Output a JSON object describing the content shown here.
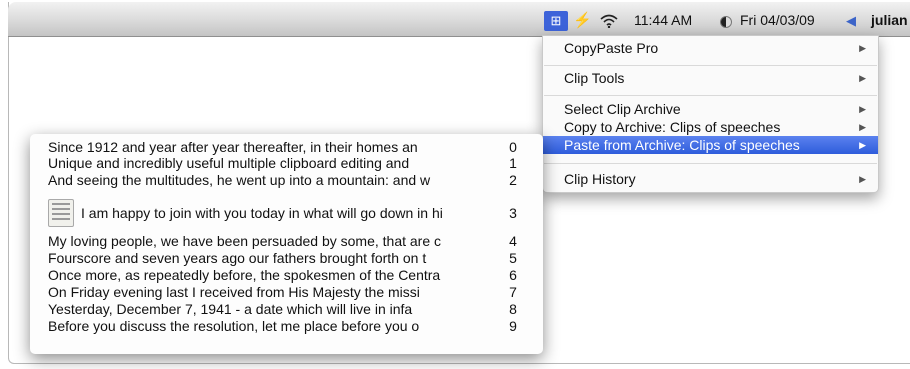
{
  "menubar": {
    "copypaste_icon": "copypaste-menu-icon",
    "bolt_icon": "bolt-icon",
    "wifi_icon": "wifi-icon",
    "time": "11:44 AM",
    "moon_icon": "moon-icon",
    "date": "Fri 04/03/09",
    "volume_icon": "speaker-icon",
    "user": "julian"
  },
  "menu": {
    "items": [
      {
        "label": "CopyPaste Pro"
      },
      {
        "label": "Clip Tools"
      },
      {
        "label": "Select Clip Archive"
      },
      {
        "label": "Copy to Archive: Clips of speeches"
      },
      {
        "label": "Paste from Archive: Clips of speeches"
      },
      {
        "label": "Clip History"
      }
    ],
    "highlight_color": "#3466e0"
  },
  "clips": [
    {
      "text": "Since 1912 and year after year thereafter, in their homes an",
      "index": "0"
    },
    {
      "text": "Unique and incredibly useful multiple clipboard editing and",
      "index": "1"
    },
    {
      "text": "And seeing the multitudes, he went up into a mountain: and w",
      "index": "2"
    },
    {
      "text": "I am happy to join with you today in what will go down in hi",
      "index": "3"
    },
    {
      "text": "My loving people, we have been persuaded by some, that are c",
      "index": "4"
    },
    {
      "text": "Fourscore and seven years ago our fathers brought forth on t",
      "index": "5"
    },
    {
      "text": "Once more, as repeatedly before, the spokesmen of the Centra",
      "index": "6"
    },
    {
      "text": "On Friday evening last I received from His Majesty the missi",
      "index": "7"
    },
    {
      "text": "Yesterday, December 7, 1941 - a date which will live in infa",
      "index": "8"
    },
    {
      "text": "Before you discuss the resolution, let me place before you o",
      "index": "9"
    }
  ]
}
